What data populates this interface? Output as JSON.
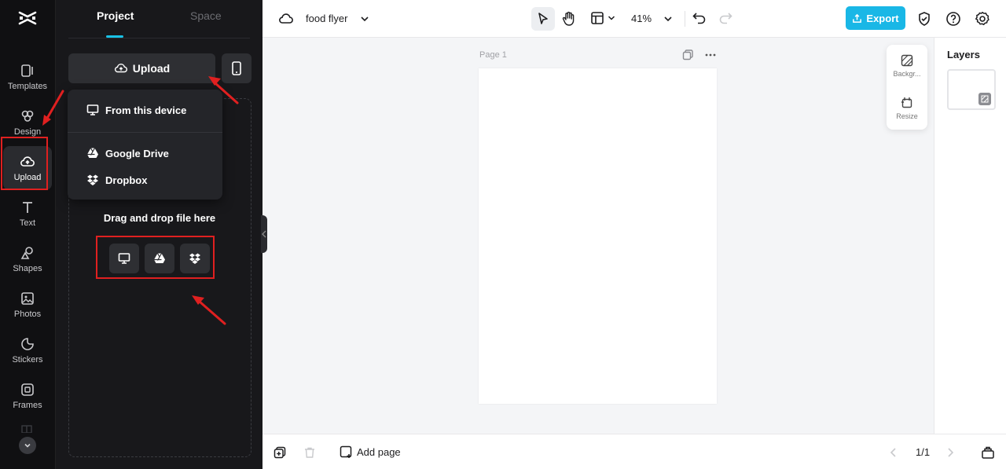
{
  "rail": {
    "items": [
      {
        "label": "Templates",
        "icon": "templates-icon"
      },
      {
        "label": "Design",
        "icon": "design-icon"
      },
      {
        "label": "Upload",
        "icon": "upload-cloud-icon",
        "active": true
      },
      {
        "label": "Text",
        "icon": "text-icon"
      },
      {
        "label": "Shapes",
        "icon": "shapes-icon"
      },
      {
        "label": "Photos",
        "icon": "photos-icon"
      },
      {
        "label": "Stickers",
        "icon": "stickers-icon"
      },
      {
        "label": "Frames",
        "icon": "frames-icon"
      }
    ]
  },
  "panel": {
    "tabs": [
      {
        "label": "Project",
        "active": true
      },
      {
        "label": "Space",
        "active": false
      }
    ],
    "upload_label": "Upload",
    "menu": {
      "items": [
        {
          "label": "From this device"
        },
        {
          "label": "Google Drive"
        },
        {
          "label": "Dropbox"
        }
      ]
    },
    "drag_text": "Drag and drop file here"
  },
  "topbar": {
    "doc_title": "food flyer",
    "zoom": "41%",
    "export_label": "Export"
  },
  "canvas": {
    "page_label": "Page 1"
  },
  "float_tools": [
    {
      "label": "Backgr..."
    },
    {
      "label": "Resize"
    }
  ],
  "layers": {
    "title": "Layers"
  },
  "bottombar": {
    "add_page_label": "Add page",
    "page_indicator": "1/1"
  },
  "colors": {
    "accent": "#19b7e6",
    "highlight": "#e02020",
    "rail_bg": "#101012",
    "panel_bg": "#18181b"
  }
}
